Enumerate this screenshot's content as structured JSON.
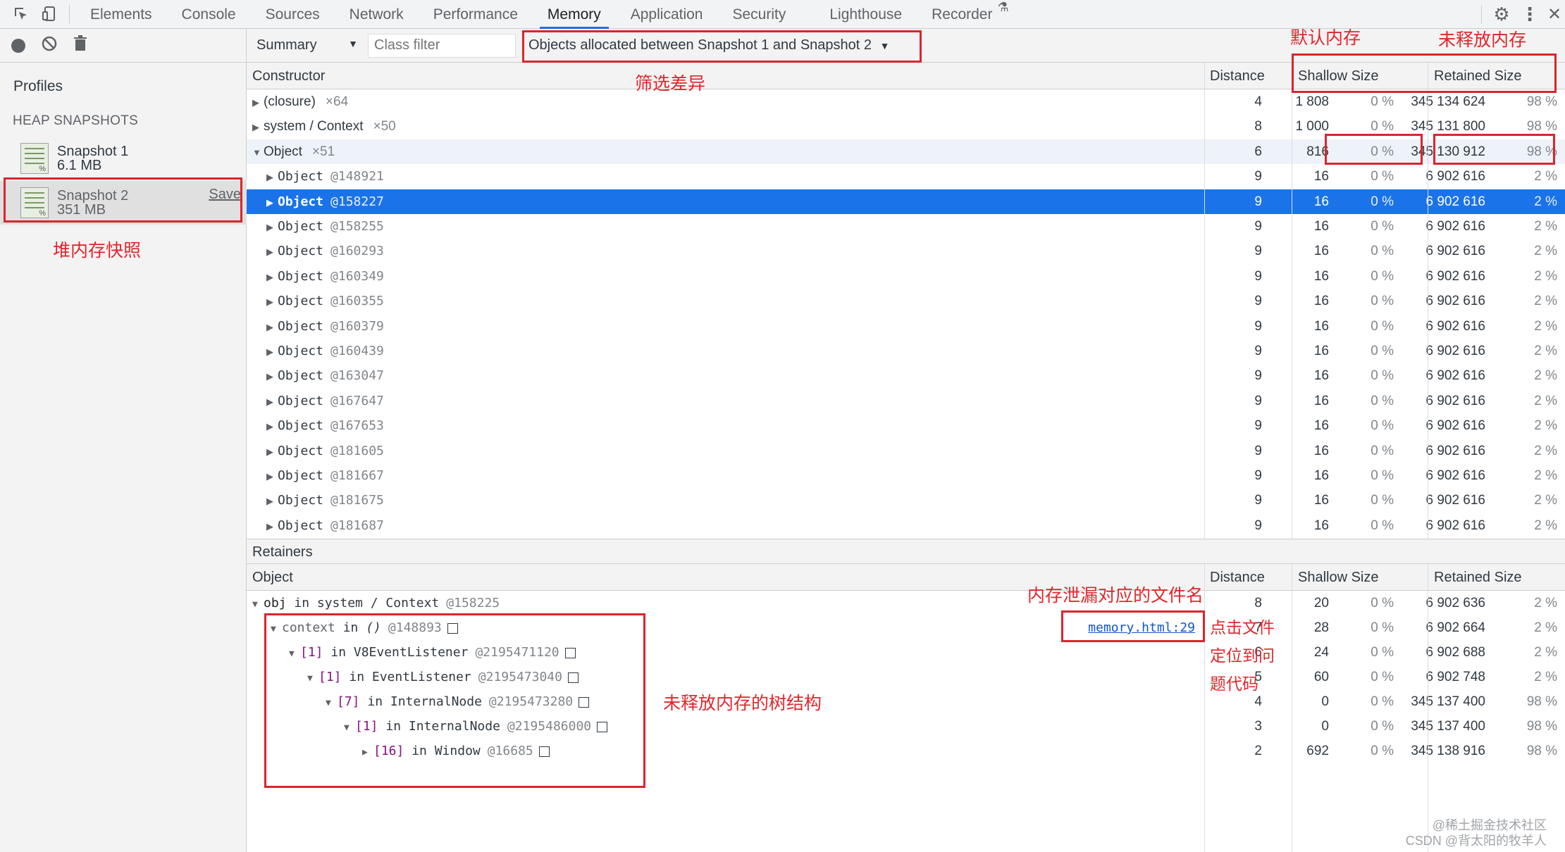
{
  "tabs": [
    "Elements",
    "Console",
    "Sources",
    "Network",
    "Performance",
    "Memory",
    "Application",
    "Security",
    "Lighthouse",
    "Recorder"
  ],
  "active_tab": "Memory",
  "sidebar": {
    "title": "Profiles",
    "section": "HEAP SNAPSHOTS",
    "snapshots": [
      {
        "name": "Snapshot 1",
        "size": "6.1 MB"
      },
      {
        "name": "Snapshot 2",
        "size": "351 MB",
        "save_label": "Save"
      }
    ]
  },
  "toolbar": {
    "view": "Summary",
    "class_filter_placeholder": "Class filter",
    "filter_select": "Objects allocated between Snapshot 1 and Snapshot 2"
  },
  "grid_headers": {
    "constructor": "Constructor",
    "distance": "Distance",
    "shallow": "Shallow Size",
    "retained": "Retained Size"
  },
  "rows": [
    {
      "name": "(closure)",
      "count": "×64",
      "distance": "4",
      "shallow": "1 808",
      "shallow_pct": "0 %",
      "retained": "345 134 624",
      "retained_pct": "98 %",
      "level": 0,
      "expanded": false
    },
    {
      "name": "system / Context",
      "count": "×50",
      "distance": "8",
      "shallow": "1 000",
      "shallow_pct": "0 %",
      "retained": "345 131 800",
      "retained_pct": "98 %",
      "level": 0,
      "expanded": false
    },
    {
      "name": "Object",
      "count": "×51",
      "distance": "6",
      "shallow": "816",
      "shallow_pct": "0 %",
      "retained": "345 130 912",
      "retained_pct": "98 %",
      "level": 0,
      "expanded": true
    },
    {
      "name": "Object",
      "id": "@148921",
      "distance": "9",
      "shallow": "16",
      "shallow_pct": "0 %",
      "retained": "6 902 616",
      "retained_pct": "2 %",
      "level": 1
    },
    {
      "name": "Object",
      "id": "@158227",
      "distance": "9",
      "shallow": "16",
      "shallow_pct": "0 %",
      "retained": "6 902 616",
      "retained_pct": "2 %",
      "level": 1,
      "selected": true
    },
    {
      "name": "Object",
      "id": "@158255",
      "distance": "9",
      "shallow": "16",
      "shallow_pct": "0 %",
      "retained": "6 902 616",
      "retained_pct": "2 %",
      "level": 1
    },
    {
      "name": "Object",
      "id": "@160293",
      "distance": "9",
      "shallow": "16",
      "shallow_pct": "0 %",
      "retained": "6 902 616",
      "retained_pct": "2 %",
      "level": 1
    },
    {
      "name": "Object",
      "id": "@160349",
      "distance": "9",
      "shallow": "16",
      "shallow_pct": "0 %",
      "retained": "6 902 616",
      "retained_pct": "2 %",
      "level": 1
    },
    {
      "name": "Object",
      "id": "@160355",
      "distance": "9",
      "shallow": "16",
      "shallow_pct": "0 %",
      "retained": "6 902 616",
      "retained_pct": "2 %",
      "level": 1
    },
    {
      "name": "Object",
      "id": "@160379",
      "distance": "9",
      "shallow": "16",
      "shallow_pct": "0 %",
      "retained": "6 902 616",
      "retained_pct": "2 %",
      "level": 1
    },
    {
      "name": "Object",
      "id": "@160439",
      "distance": "9",
      "shallow": "16",
      "shallow_pct": "0 %",
      "retained": "6 902 616",
      "retained_pct": "2 %",
      "level": 1
    },
    {
      "name": "Object",
      "id": "@163047",
      "distance": "9",
      "shallow": "16",
      "shallow_pct": "0 %",
      "retained": "6 902 616",
      "retained_pct": "2 %",
      "level": 1
    },
    {
      "name": "Object",
      "id": "@167647",
      "distance": "9",
      "shallow": "16",
      "shallow_pct": "0 %",
      "retained": "6 902 616",
      "retained_pct": "2 %",
      "level": 1
    },
    {
      "name": "Object",
      "id": "@167653",
      "distance": "9",
      "shallow": "16",
      "shallow_pct": "0 %",
      "retained": "6 902 616",
      "retained_pct": "2 %",
      "level": 1
    },
    {
      "name": "Object",
      "id": "@181605",
      "distance": "9",
      "shallow": "16",
      "shallow_pct": "0 %",
      "retained": "6 902 616",
      "retained_pct": "2 %",
      "level": 1
    },
    {
      "name": "Object",
      "id": "@181667",
      "distance": "9",
      "shallow": "16",
      "shallow_pct": "0 %",
      "retained": "6 902 616",
      "retained_pct": "2 %",
      "level": 1
    },
    {
      "name": "Object",
      "id": "@181675",
      "distance": "9",
      "shallow": "16",
      "shallow_pct": "0 %",
      "retained": "6 902 616",
      "retained_pct": "2 %",
      "level": 1
    },
    {
      "name": "Object",
      "id": "@181687",
      "distance": "9",
      "shallow": "16",
      "shallow_pct": "0 %",
      "retained": "6 902 616",
      "retained_pct": "2 %",
      "level": 1
    }
  ],
  "retainers": {
    "title": "Retainers",
    "headers": {
      "object": "Object",
      "distance": "Distance",
      "shallow": "Shallow Size",
      "retained": "Retained Size"
    },
    "rows": [
      {
        "prefix": "obj",
        "mid": " in ",
        "name": "system / Context",
        "id": "@158225",
        "level": 0,
        "distance": "8",
        "shallow": "20",
        "shallow_pct": "0 %",
        "retained": "6 902 636",
        "retained_pct": "2 %",
        "checkbox": false
      },
      {
        "prefix": "context",
        "mid": " in ",
        "name": "()",
        "id": "@148893",
        "level": 1,
        "distance": "7",
        "shallow": "28",
        "shallow_pct": "0 %",
        "retained": "6 902 664",
        "retained_pct": "2 %",
        "checkbox": true,
        "link": "memory.html:29"
      },
      {
        "prefix": "[1]",
        "mid": " in ",
        "name": "V8EventListener",
        "id": "@2195471120",
        "level": 2,
        "distance": "6",
        "shallow": "24",
        "shallow_pct": "0 %",
        "retained": "6 902 688",
        "retained_pct": "2 %",
        "checkbox": true
      },
      {
        "prefix": "[1]",
        "mid": " in ",
        "name": "EventListener",
        "id": "@2195473040",
        "level": 3,
        "distance": "5",
        "shallow": "60",
        "shallow_pct": "0 %",
        "retained": "6 902 748",
        "retained_pct": "2 %",
        "checkbox": true
      },
      {
        "prefix": "[7]",
        "mid": " in ",
        "name": "InternalNode",
        "id": "@2195473280",
        "level": 4,
        "distance": "4",
        "shallow": "0",
        "shallow_pct": "0 %",
        "retained": "345 137 400",
        "retained_pct": "98 %",
        "checkbox": true
      },
      {
        "prefix": "[1]",
        "mid": " in ",
        "name": "InternalNode",
        "id": "@2195486000",
        "level": 5,
        "distance": "3",
        "shallow": "0",
        "shallow_pct": "0 %",
        "retained": "345 137 400",
        "retained_pct": "98 %",
        "checkbox": true
      },
      {
        "prefix": "[16]",
        "mid": " in ",
        "name": "Window",
        "id": "@16685",
        "level": 6,
        "distance": "2",
        "shallow": "692",
        "shallow_pct": "0 %",
        "retained": "345 138 916",
        "retained_pct": "98 %",
        "checkbox": true,
        "collapsed": true
      }
    ]
  },
  "annotations": {
    "default_memory": "默认内存",
    "unreleased_memory": "未释放内存",
    "filter_diff": "筛选差异",
    "heap_snapshot": "堆内存快照",
    "leak_filename": "内存泄漏对应的文件名",
    "click_file_1": "点击文件",
    "click_file_2": "定位到问",
    "click_file_3": "题代码",
    "tree_structure": "未释放内存的树结构"
  },
  "watermark": {
    "line1": "@稀土掘金技术社区",
    "line2": "CSDN @背太阳的牧羊人"
  },
  "colors": {
    "accent": "#1a73e8",
    "annotation_red": "#d9262c",
    "link": "#1155cc"
  }
}
